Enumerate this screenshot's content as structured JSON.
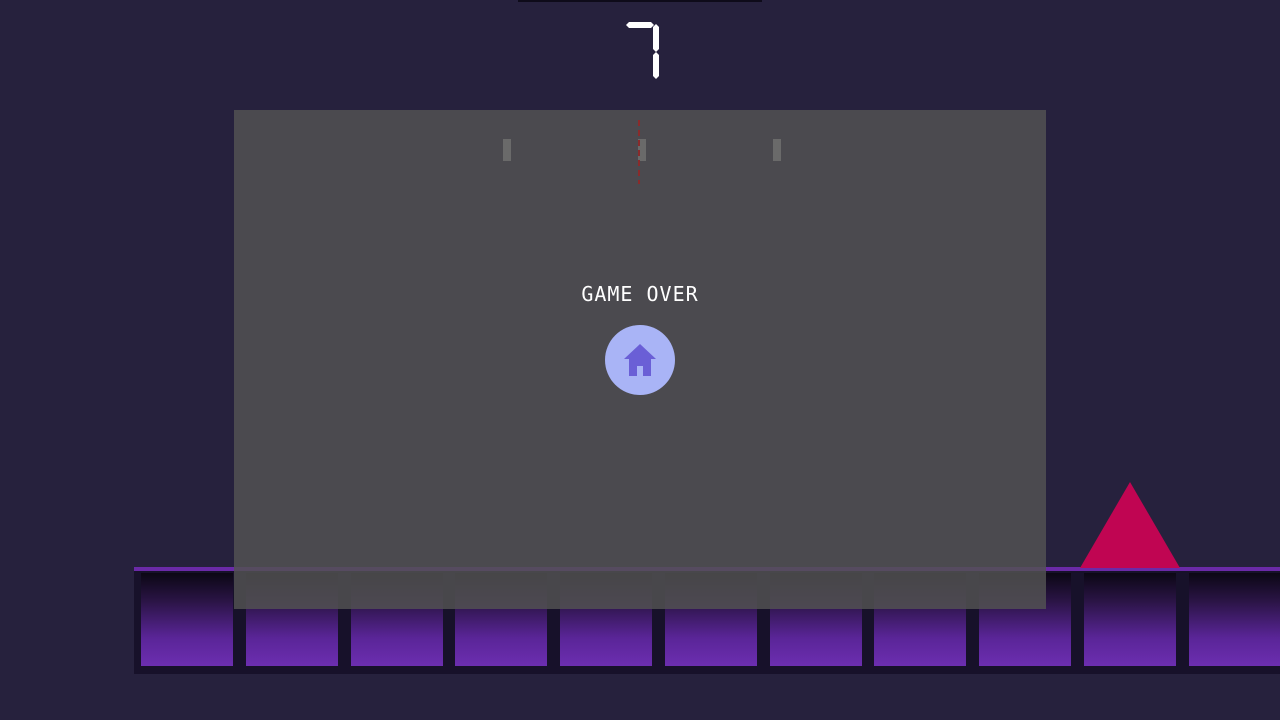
{
  "hud": {
    "score": "7"
  },
  "game_over": {
    "title": "GAME OVER",
    "home_button_icon": "home-icon"
  },
  "colors": {
    "background": "#26213d",
    "panel": "#525252",
    "spike": "#c00552",
    "ground_block": "#6c2eb0",
    "home_button": "#a9b4f6",
    "home_icon": "#6a5fd6",
    "score": "#ffffff"
  }
}
